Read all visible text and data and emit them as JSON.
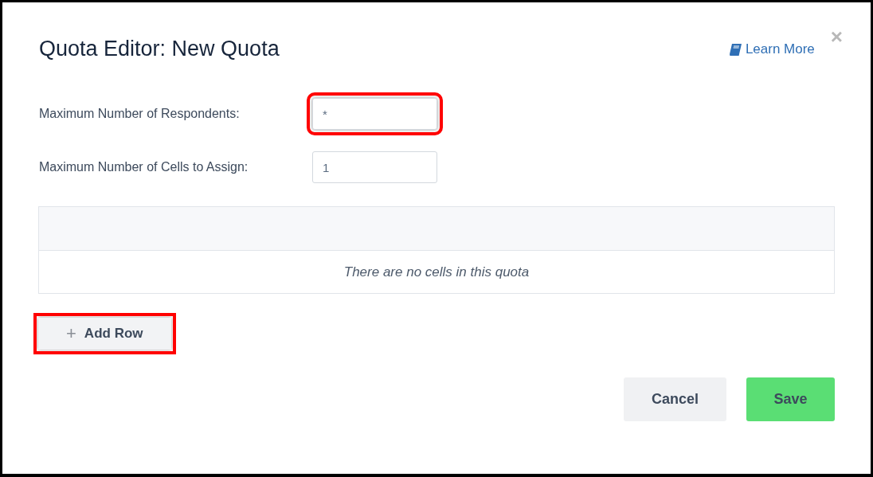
{
  "dialog": {
    "title": "Quota Editor: New Quota",
    "help_link": "Learn More",
    "close": "×"
  },
  "fields": [
    {
      "label": "Maximum Number of Respondents:",
      "value": "*",
      "highlighted": true
    },
    {
      "label": "Maximum Number of Cells to Assign:",
      "value": "1",
      "highlighted": false
    }
  ],
  "table": {
    "empty_message": "There are no cells in this quota"
  },
  "add_row": {
    "icon": "+",
    "label": "Add Row",
    "highlighted": true
  },
  "buttons": [
    {
      "label": "Cancel",
      "kind": "secondary"
    },
    {
      "label": "Save",
      "kind": "primary"
    }
  ]
}
